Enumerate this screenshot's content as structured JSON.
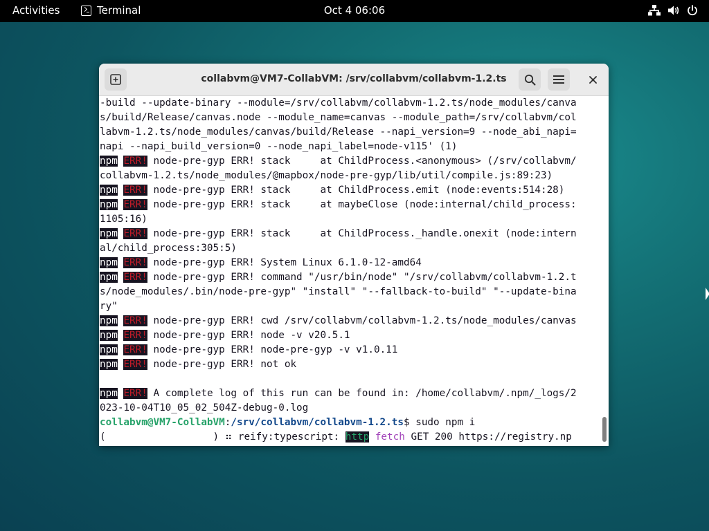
{
  "topbar": {
    "activities": "Activities",
    "app_name": "Terminal",
    "clock": "Oct 4  06:06",
    "tray_icons": [
      "network-icon",
      "volume-icon",
      "power-icon"
    ]
  },
  "window": {
    "title": "collabvm@VM7-CollabVM: /srv/collabvm/collabvm-1.2.ts",
    "buttons": [
      "new-tab-icon",
      "search-icon",
      "hamburger-menu-icon",
      "close-icon"
    ]
  },
  "terminal": {
    "colors": {
      "err": "#c01c28",
      "prompt_user": "#26a269",
      "prompt_path": "#12488b",
      "http": "#26a269",
      "fetch": "#a347ba",
      "fg": "#171421"
    },
    "lines": [
      {
        "type": "plain",
        "text": "-build --update-binary --module=/srv/collabvm/collabvm-1.2.ts/node_modules/canva"
      },
      {
        "type": "plain",
        "text": "s/build/Release/canvas.node --module_name=canvas --module_path=/srv/collabvm/col"
      },
      {
        "type": "plain",
        "text": "labvm-1.2.ts/node_modules/canvas/build/Release --napi_version=9 --node_abi_napi="
      },
      {
        "type": "plain",
        "text": "napi --napi_build_version=0 --node_napi_label=node-v115' (1)"
      },
      {
        "type": "npm",
        "npm": "npm",
        "err": "ERR!",
        "text": " node-pre-gyp ERR! stack     at ChildProcess.<anonymous> (/srv/collabvm/"
      },
      {
        "type": "plain",
        "text": "collabvm-1.2.ts/node_modules/@mapbox/node-pre-gyp/lib/util/compile.js:89:23)"
      },
      {
        "type": "npm",
        "npm": "npm",
        "err": "ERR!",
        "text": " node-pre-gyp ERR! stack     at ChildProcess.emit (node:events:514:28)"
      },
      {
        "type": "npm",
        "npm": "npm",
        "err": "ERR!",
        "text": " node-pre-gyp ERR! stack     at maybeClose (node:internal/child_process:"
      },
      {
        "type": "plain",
        "text": "1105:16)"
      },
      {
        "type": "npm",
        "npm": "npm",
        "err": "ERR!",
        "text": " node-pre-gyp ERR! stack     at ChildProcess._handle.onexit (node:intern"
      },
      {
        "type": "plain",
        "text": "al/child_process:305:5)"
      },
      {
        "type": "npm",
        "npm": "npm",
        "err": "ERR!",
        "text": " node-pre-gyp ERR! System Linux 6.1.0-12-amd64"
      },
      {
        "type": "npm",
        "npm": "npm",
        "err": "ERR!",
        "text": " node-pre-gyp ERR! command \"/usr/bin/node\" \"/srv/collabvm/collabvm-1.2.t"
      },
      {
        "type": "plain",
        "text": "s/node_modules/.bin/node-pre-gyp\" \"install\" \"--fallback-to-build\" \"--update-bina"
      },
      {
        "type": "plain",
        "text": "ry\""
      },
      {
        "type": "npm",
        "npm": "npm",
        "err": "ERR!",
        "text": " node-pre-gyp ERR! cwd /srv/collabvm/collabvm-1.2.ts/node_modules/canvas"
      },
      {
        "type": "npm",
        "npm": "npm",
        "err": "ERR!",
        "text": " node-pre-gyp ERR! node -v v20.5.1"
      },
      {
        "type": "npm",
        "npm": "npm",
        "err": "ERR!",
        "text": " node-pre-gyp ERR! node-pre-gyp -v v1.0.11"
      },
      {
        "type": "npm",
        "npm": "npm",
        "err": "ERR!",
        "text": " node-pre-gyp ERR! not ok"
      },
      {
        "type": "plain",
        "text": ""
      },
      {
        "type": "npm",
        "npm": "npm",
        "err": "ERR!",
        "text": " A complete log of this run can be found in: /home/collabvm/.npm/_logs/2"
      },
      {
        "type": "plain",
        "text": "023-10-04T10_05_02_504Z-debug-0.log"
      },
      {
        "type": "prompt",
        "user": "collabvm@VM7-CollabVM",
        "sep": ":",
        "path": "/srv/collabvm/collabvm-1.2.ts",
        "cmd": "$ sudo npm i"
      },
      {
        "type": "progress",
        "prefix": "(                  ) ⠶ reify:typescript: ",
        "http": "http",
        "fetch": "fetch",
        "rest": " GET 200 https://registry.np"
      }
    ]
  }
}
